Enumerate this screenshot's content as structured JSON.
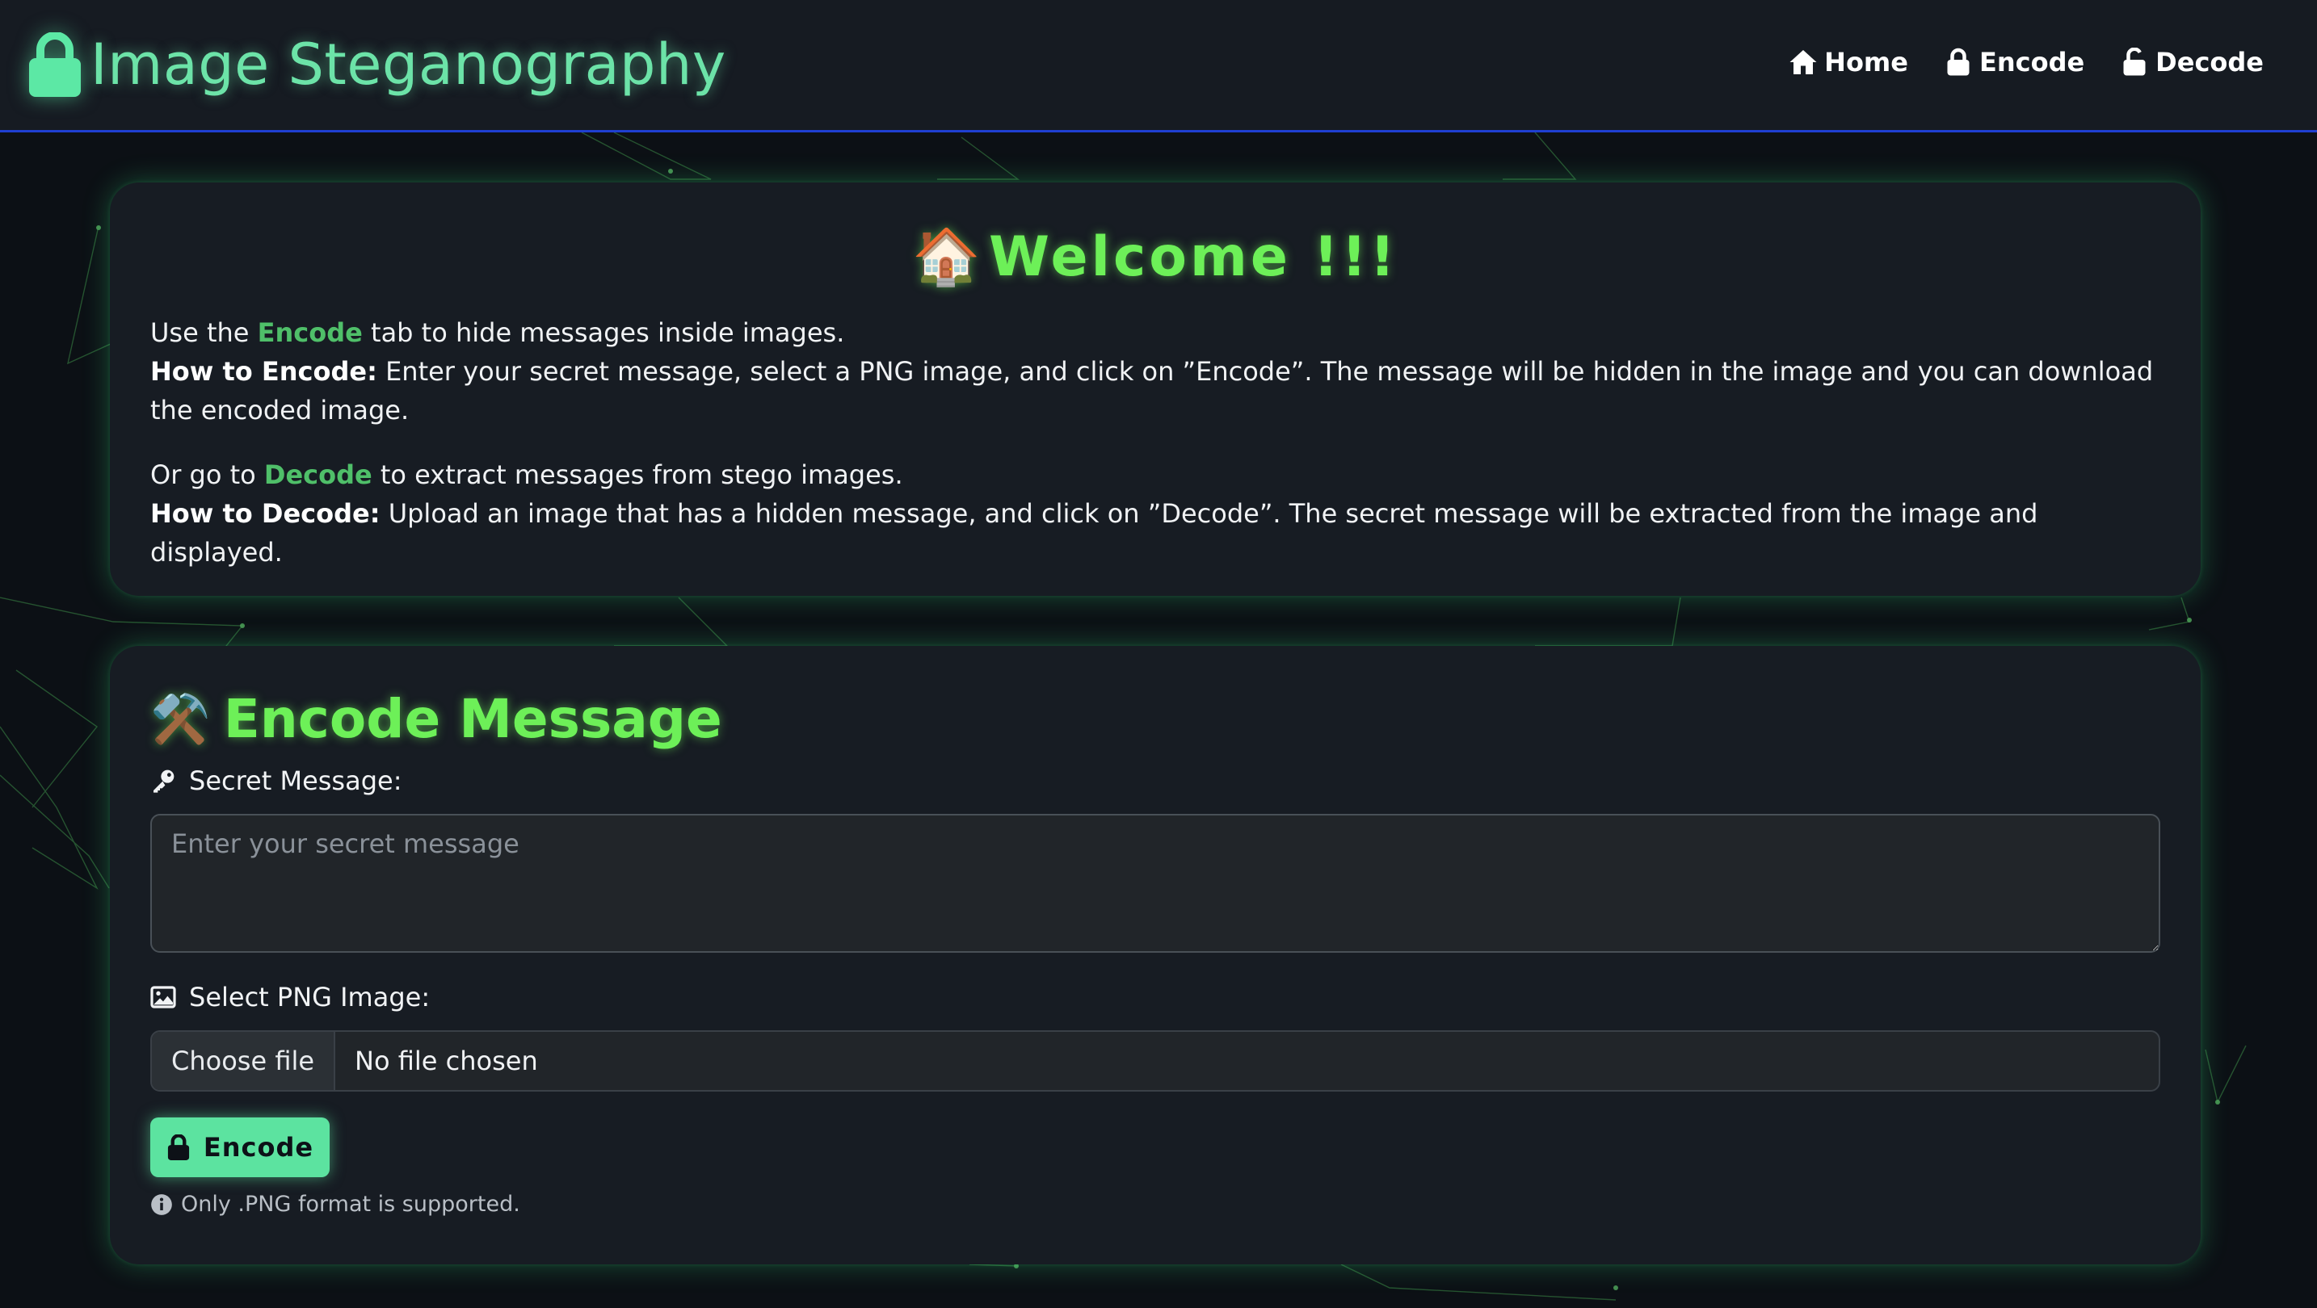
{
  "navbar": {
    "brand_title": "Image Steganography",
    "links": [
      {
        "label": "Home",
        "icon": "house-icon"
      },
      {
        "label": "Encode",
        "icon": "lock-icon"
      },
      {
        "label": "Decode",
        "icon": "unlock-icon"
      }
    ]
  },
  "welcome": {
    "emoji": "🏠",
    "title": "Welcome !!!",
    "encode_line": {
      "pre": "Use the ",
      "link": "Encode",
      "post": " tab to hide messages inside images."
    },
    "encode_howto": {
      "label": "How to Encode:",
      "text": " Enter your secret message, select a PNG image, and click on ”Encode”. The message will be hidden in the image and you can download the encoded image."
    },
    "decode_line": {
      "pre": "Or go to ",
      "link": "Decode",
      "post": " to extract messages from stego images."
    },
    "decode_howto": {
      "label": "How to Decode:",
      "text": " Upload an image that has a hidden message, and click on ”Decode”. The secret message will be extracted from the image and displayed."
    }
  },
  "encode_form": {
    "emoji": "⚒️",
    "title": "Encode Message",
    "message_label": "Secret Message:",
    "message_placeholder": "Enter your secret message",
    "message_value": "",
    "image_label": "Select PNG Image:",
    "file_button": "Choose file",
    "file_status": "No file chosen",
    "submit_label": "Encode",
    "hint": "Only .PNG format is supported."
  },
  "colors": {
    "accent_green": "#6df058",
    "brand_mint": "#6ce3a8",
    "button_mint": "#5ce3a0",
    "link_green": "#4fbf69",
    "navbar_border_blue": "#1f3fd1",
    "background": "#0c1015",
    "card": "#171c23"
  }
}
